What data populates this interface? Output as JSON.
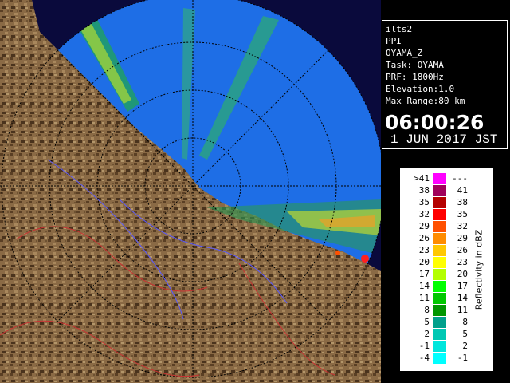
{
  "info": {
    "lines": [
      "ilts2",
      "PPI",
      "OYAMA_Z",
      "Task: OYAMA",
      "PRF: 1800Hz",
      "Elevation:1.0",
      "Max Range:80 km"
    ],
    "time": "06:00:26",
    "date": "1 JUN 2017 JST"
  },
  "legend": {
    "title": "Reflectivity in dBZ",
    "rows": [
      {
        "low": ">41",
        "high": "---",
        "color": "#ff00ff"
      },
      {
        "low": "38",
        "high": "41",
        "color": "#a0005a"
      },
      {
        "low": "35",
        "high": "38",
        "color": "#b40000"
      },
      {
        "low": "32",
        "high": "35",
        "color": "#ff0000"
      },
      {
        "low": "29",
        "high": "32",
        "color": "#ff5000"
      },
      {
        "low": "26",
        "high": "29",
        "color": "#ff8c00"
      },
      {
        "low": "23",
        "high": "26",
        "color": "#ffc800"
      },
      {
        "low": "20",
        "high": "23",
        "color": "#ffff00"
      },
      {
        "low": "17",
        "high": "20",
        "color": "#b4ff00"
      },
      {
        "low": "14",
        "high": "17",
        "color": "#00ff00"
      },
      {
        "low": "11",
        "high": "14",
        "color": "#00c800"
      },
      {
        "low": "8",
        "high": "11",
        "color": "#009600"
      },
      {
        "low": "5",
        "high": "8",
        "color": "#00a08c"
      },
      {
        "low": "2",
        "high": "5",
        "color": "#00c8b4"
      },
      {
        "low": "-1",
        "high": "2",
        "color": "#00e6dc"
      },
      {
        "low": "-4",
        "high": "-1",
        "color": "#00ffff"
      }
    ]
  },
  "colors": {
    "radar_background": "#1e6ee6",
    "terrain": "#8c6e4a",
    "panel_border": "#ffffff"
  }
}
